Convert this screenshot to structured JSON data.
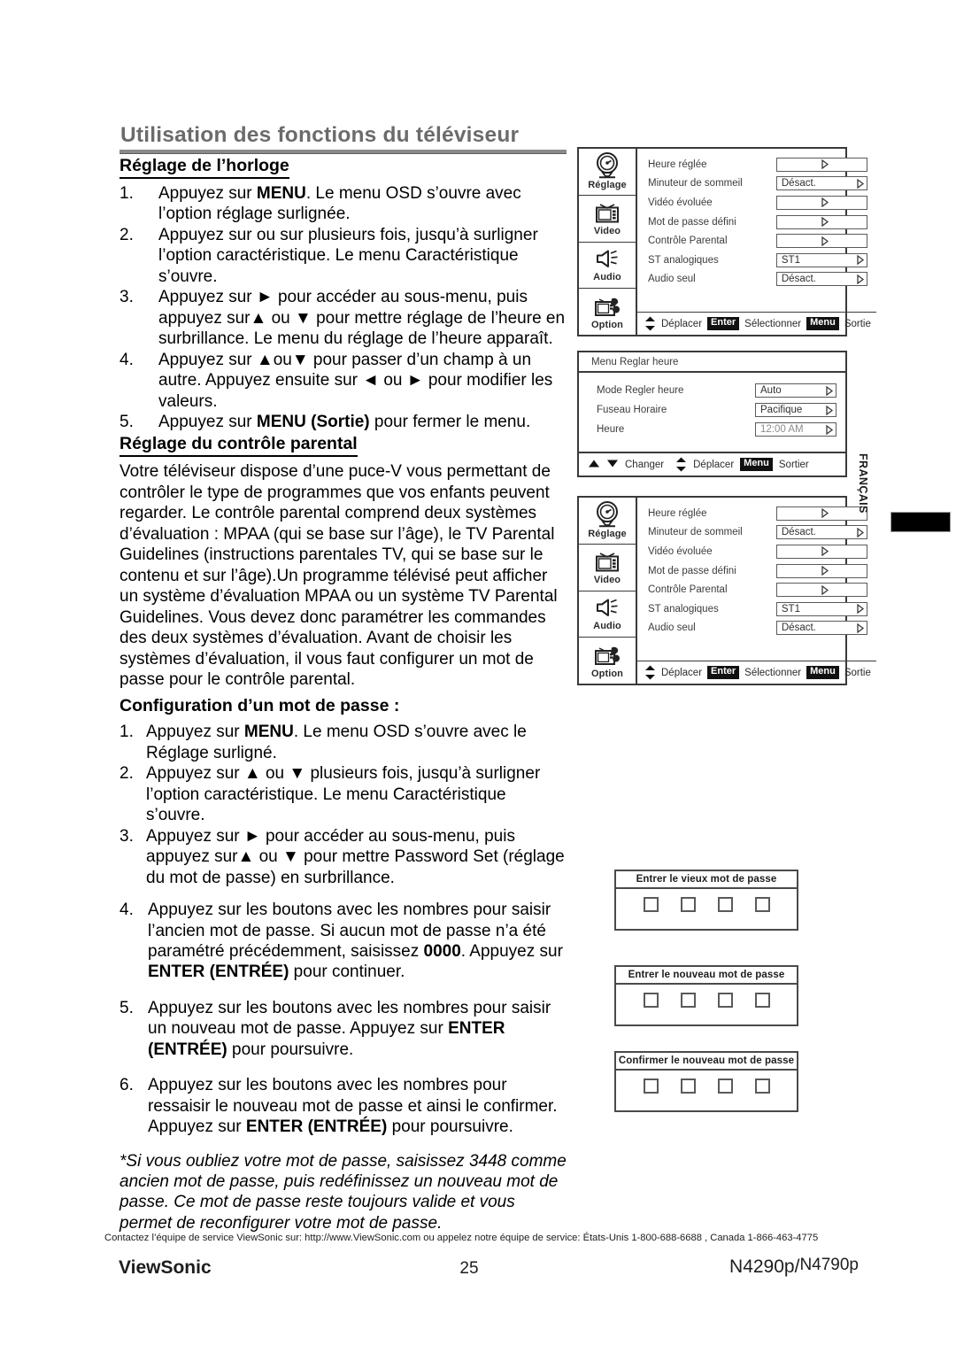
{
  "header": {
    "title": "Utilisation des fonctions du téléviseur"
  },
  "sections": {
    "clock": {
      "heading": "Réglage de l’horloge",
      "steps": [
        {
          "num": "1.",
          "text_before": "Appuyez sur ",
          "bold": "MENU",
          "text_after": ". Le menu OSD s’ouvre avec l’option réglage surlignée."
        },
        {
          "num": "2.",
          "text_before": "Appuyez sur ou sur plusieurs fois, jusqu’à surligner l’option caractéristique. Le menu Caractéristique s’ouvre.",
          "bold": "",
          "text_after": ""
        },
        {
          "num": "3.",
          "text_before": "Appuyez sur ► pour accéder au sous-menu, puis appuyez sur▲ ou ▼ pour mettre réglage de l’heure en surbrillance. Le menu du réglage de l’heure apparaît.",
          "bold": "",
          "text_after": ""
        },
        {
          "num": "4.",
          "text_before": "Appuyez sur ▲ou▼ pour passer d’un champ à un autre. Appuyez ensuite sur ◄ ou ► pour modifier les valeurs.",
          "bold": "",
          "text_after": ""
        },
        {
          "num": "5.",
          "text_before": "Appuyez sur ",
          "bold": "MENU (Sortie)",
          "text_after": " pour fermer le menu."
        }
      ]
    },
    "parental": {
      "heading": "Réglage du contrôle parental",
      "body": "Votre téléviseur dispose d’une puce-V vous permettant de contrôler le type de programmes que vos enfants peuvent regarder. Le contrôle parental comprend deux systèmes d’évaluation : MPAA (qui se base sur l’âge), le TV Parental Guidelines (instructions parentales TV, qui se base sur le contenu et sur l’âge).Un programme télévisé peut afficher un système d’évaluation MPAA ou un système TV Parental Guidelines. Vous devez donc paramétrer les commandes des deux systèmes d’évaluation. Avant de choisir les systèmes d’évaluation, il vous faut configurer un mot de passe pour le contrôle parental."
    },
    "password": {
      "heading": "Configuration d’un mot de passe :",
      "steps_group1": [
        {
          "num": "1.",
          "text_before": "Appuyez sur ",
          "bold": "MENU",
          "text_after": ". Le menu OSD s’ouvre avec le Réglage surligné."
        },
        {
          "num": "2.",
          "text_before": "Appuyez sur ▲ ou ▼ plusieurs fois, jusqu’à surligner l’option caractéristique. Le menu Caractéristique s’ouvre.",
          "bold": "",
          "text_after": ""
        },
        {
          "num": "3.",
          "text_before": "Appuyez sur ► pour accéder au sous-menu, puis appuyez sur▲ ou ▼ pour mettre Password Set (réglage du mot de passe) en surbrillance.",
          "bold": "",
          "text_after": ""
        }
      ],
      "steps_group2": [
        {
          "num": "4.",
          "p1": "Appuyez sur les boutons avec les nombres pour saisir l’ancien mot de passe. Si aucun mot de passe n’a été paramétré précédemment, saisissez ",
          "b1": "0000",
          "p2": ". Appuyez sur ",
          "b2": "ENTER (ENTRÉE)",
          "p3": " pour continuer."
        },
        {
          "num": "5.",
          "p1": "Appuyez sur les boutons avec les nombres pour saisir un nouveau mot de passe. Appuyez sur ",
          "b1": "",
          "p2": "",
          "b2": "ENTER (ENTRÉE)",
          "p3": " pour poursuivre."
        },
        {
          "num": "6.",
          "p1": "Appuyez sur les boutons avec les nombres pour ressaisir le nouveau mot de passe et ainsi le confirmer. Appuyez sur ",
          "b1": "",
          "p2": "",
          "b2": "ENTER (ENTRÉE)",
          "p3": " pour poursuivre."
        }
      ],
      "note": "*Si vous oubliez votre mot de passe, saisissez 3448 comme ancien mot de passe, puis redéfinissez un nouveau mot de passe. Ce mot de passe reste toujours valide et vous permet de reconfigurer votre mot de passe."
    }
  },
  "osd_setup": {
    "sidebar": [
      {
        "label": "Réglage",
        "icon": "clock-dial-icon"
      },
      {
        "label": "Video",
        "icon": "tv-icon"
      },
      {
        "label": "Audio",
        "icon": "speaker-icon"
      },
      {
        "label": "Option",
        "icon": "tv-tool-icon"
      }
    ],
    "rows": [
      {
        "label": "Heure réglée",
        "value": ""
      },
      {
        "label": "Minuteur de sommeil",
        "value": "Désact."
      },
      {
        "label": "Vidéo évoluée",
        "value": ""
      },
      {
        "label": "Mot de passe défini",
        "value": ""
      },
      {
        "label": "Contrôle Parental",
        "value": ""
      },
      {
        "label": "ST analogiques",
        "value": "ST1"
      },
      {
        "label": "Audio seul",
        "value": "Désact."
      }
    ],
    "footer": {
      "move": "Déplacer",
      "enter_key": "Enter",
      "select": "Sélectionner",
      "menu_key": "Menu",
      "exit": "Sortie"
    }
  },
  "osd_clock": {
    "title": "Menu Reglar heure",
    "rows": [
      {
        "label": "Mode Regler heure",
        "value": "Auto",
        "dim": false
      },
      {
        "label": "Fuseau Horaire",
        "value": "Pacifique",
        "dim": false
      },
      {
        "label": "Heure",
        "value": "12:00 AM",
        "dim": true
      }
    ],
    "footer": {
      "change": "Changer",
      "move": "Déplacer",
      "menu_key": "Menu",
      "exit": "Sortier"
    }
  },
  "password_dialogs": [
    {
      "title": "Entrer le vieux mot de passe",
      "cells": 4
    },
    {
      "title": "Entrer le nouveau mot de passe",
      "cells": 4
    },
    {
      "title": "Confirmer le nouveau mot de passe",
      "cells": 4
    }
  ],
  "side_tab": {
    "language": "FRANÇAIS"
  },
  "footer": {
    "contact": "Contactez l’équipe de service ViewSonic sur: http://www.ViewSonic.com ou appelez notre équipe de service: États-Unis 1-800-688-6688 , Canada 1-866-463-4775",
    "brand": "ViewSonic",
    "page_number": "25",
    "model_left": "N4290p/",
    "model_right": "N4790p"
  },
  "colors": {
    "title_gray": "#6b6b6b",
    "rule_gray": "#8a8a8a",
    "osd_border": "#3a3a3a",
    "key_bg": "#111111"
  }
}
